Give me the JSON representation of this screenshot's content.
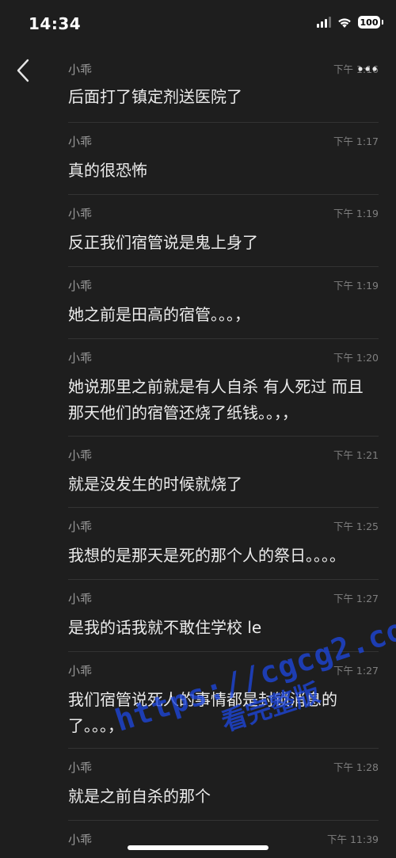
{
  "status_bar": {
    "time": "14:34",
    "battery": "100",
    "icons": [
      "signal-icon",
      "wifi-icon",
      "battery-icon"
    ]
  },
  "nav": {
    "back_icon": "chevron-left-icon",
    "more_icon": "ellipsis-icon"
  },
  "messages": [
    {
      "sender": "小乖",
      "time": "下午 1:16",
      "text": "后面打了镇定剂送医院了"
    },
    {
      "sender": "小乖",
      "time": "下午 1:17",
      "text": "真的很恐怖"
    },
    {
      "sender": "小乖",
      "time": "下午 1:19",
      "text": "反正我们宿管说是鬼上身了"
    },
    {
      "sender": "小乖",
      "time": "下午 1:19",
      "text": "她之前是田高的宿管。。。，"
    },
    {
      "sender": "小乖",
      "time": "下午 1:20",
      "text": "她说那里之前就是有人自杀 有人死过 而且那天他们的宿管还烧了纸钱。。，，"
    },
    {
      "sender": "小乖",
      "time": "下午 1:21",
      "text": "就是没发生的时候就烧了"
    },
    {
      "sender": "小乖",
      "time": "下午 1:25",
      "text": "我想的是那天是死的那个人的祭日。。。。"
    },
    {
      "sender": "小乖",
      "time": "下午 1:27",
      "text": "是我的话我就不敢住学校 le"
    },
    {
      "sender": "小乖",
      "time": "下午 1:27",
      "text": "我们宿管说死人的事情都是封锁消息的了。。。，"
    },
    {
      "sender": "小乖",
      "time": "下午 1:28",
      "text": "就是之前自杀的那个"
    },
    {
      "sender": "小乖",
      "time": "下午 11:39",
      "text": ""
    }
  ],
  "watermark": {
    "url": "https://cgcg2.co",
    "subtitle": "看完整版"
  },
  "colors": {
    "background": "#1e1e1e",
    "divider": "#333333",
    "text": "#ececec",
    "meta": "#9a9a9a",
    "watermark": "#1e46dc"
  }
}
